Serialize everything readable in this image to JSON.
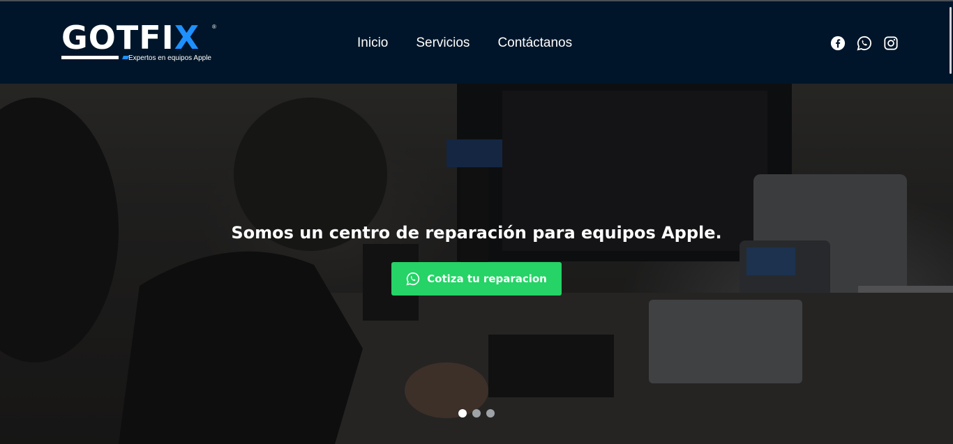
{
  "brand": {
    "wordmark": "GOTFI",
    "wordmark_accent": "X",
    "registered_mark": "®",
    "tagline": "Expertos en equipos Apple",
    "accent_color": "#1e90ff"
  },
  "nav": {
    "items": [
      {
        "label": "Inicio"
      },
      {
        "label": "Servicios"
      },
      {
        "label": "Contáctanos"
      }
    ]
  },
  "social": {
    "icons": [
      "facebook-icon",
      "whatsapp-icon",
      "instagram-icon"
    ]
  },
  "hero": {
    "title": "Somos un centro de reparación para equipos Apple.",
    "cta_label": "Cotiza tu reparacion",
    "cta_icon": "whatsapp-icon",
    "cta_color": "#25d366",
    "slides": {
      "count": 3,
      "active_index": 0
    }
  },
  "colors": {
    "header_bg": "#001529",
    "dot_active": "#ffffff",
    "dot_inactive": "#9ea3a8"
  }
}
